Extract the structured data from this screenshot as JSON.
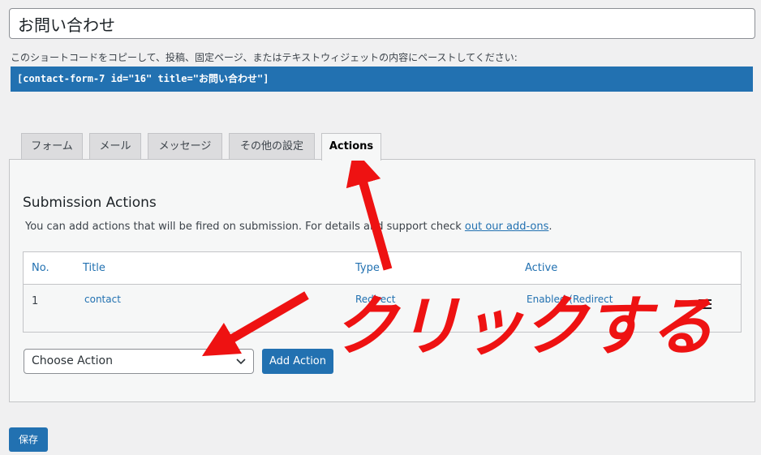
{
  "form_title": "お問い合わせ",
  "shortcode_help": "このショートコードをコピーして、投稿、固定ページ、またはテキストウィジェットの内容にペーストしてください:",
  "shortcode": "[contact-form-7 id=\"16\" title=\"お問い合わせ\"]",
  "tabs": [
    {
      "label": "フォーム"
    },
    {
      "label": "メール"
    },
    {
      "label": "メッセージ"
    },
    {
      "label": "その他の設定"
    },
    {
      "label": "Actions",
      "active": true
    }
  ],
  "actions_panel": {
    "title": "Submission Actions",
    "description": "You can add actions that will be fired on submission. For details and support check ",
    "link_text": "out our add-ons",
    "description_end": ".",
    "columns": [
      "No.",
      "Title",
      "Type",
      "Active"
    ],
    "rows": [
      {
        "no": "1",
        "title": "contact",
        "type": "Redirect",
        "active": "Enabled (Redirect"
      }
    ],
    "select_value": "Choose Action",
    "add_button": "Add Action"
  },
  "save_button": "保存",
  "annotation_text": "クリックする",
  "colors": {
    "accent": "#2271b1",
    "annotation": "#ee1212"
  }
}
